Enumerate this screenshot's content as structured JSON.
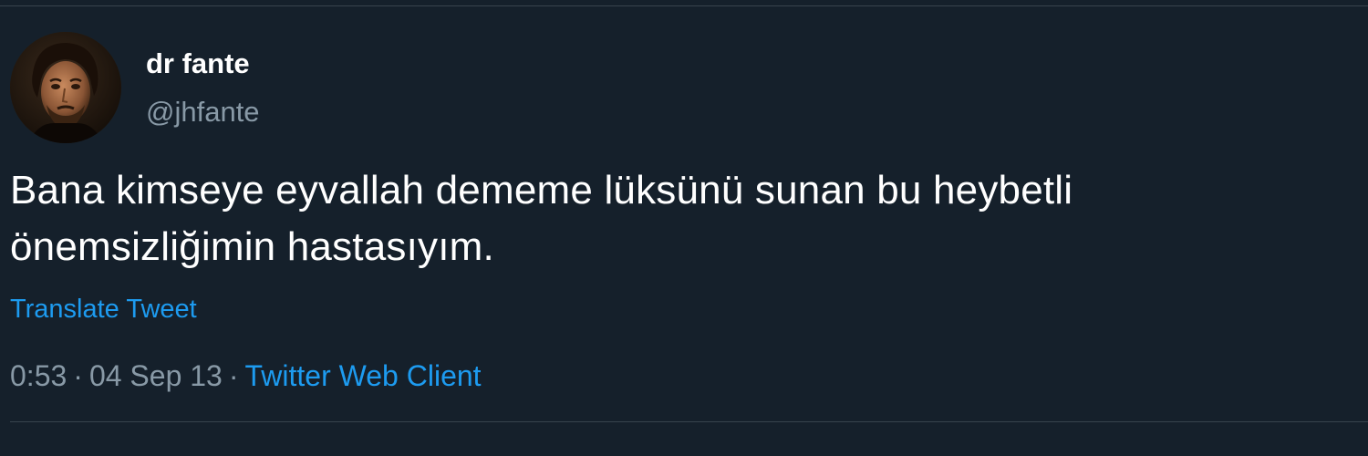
{
  "tweet": {
    "author": {
      "display_name": "dr fante",
      "handle": "@jhfante",
      "avatar_icon": "portrait-avatar"
    },
    "text_line1": "Bana kimseye eyvallah dememe lüksünü sunan bu heybetli",
    "text_line2": "önemsizliğimin hastasıyım.",
    "translate_label": "Translate Tweet",
    "time": "0:53",
    "date": "04 Sep 13",
    "separator": "·",
    "source": "Twitter Web Client"
  },
  "colors": {
    "background": "#15202b",
    "link": "#1d9bf0",
    "secondary_text": "#8899a6",
    "divider": "#38444d"
  }
}
